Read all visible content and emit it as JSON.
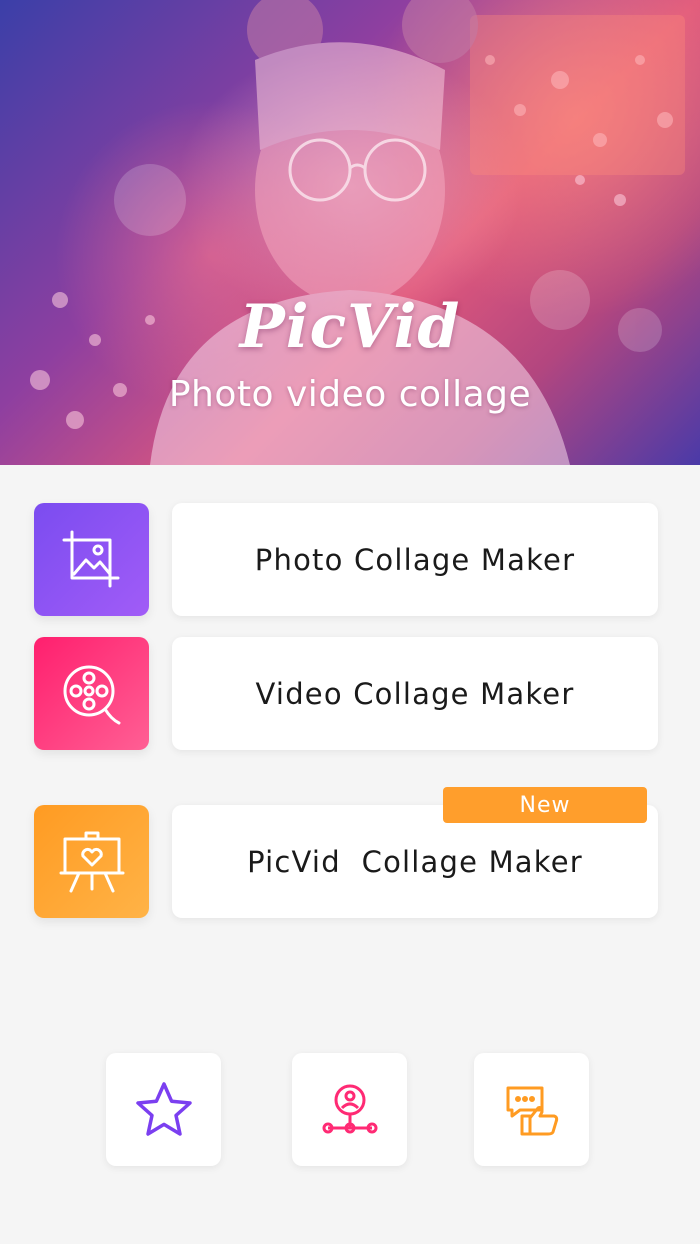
{
  "hero": {
    "title": "PicVid",
    "subtitle": "Photo video collage"
  },
  "menu": [
    {
      "label": "Photo Collage Maker",
      "icon": "crop-image-icon",
      "colors": [
        "#7b4cf0",
        "#a15cf7"
      ]
    },
    {
      "label": "Video Collage Maker",
      "icon": "film-reel-icon",
      "colors": [
        "#ff1f6e",
        "#ff5f94"
      ]
    },
    {
      "label": "PicVid  Collage Maker",
      "icon": "easel-heart-icon",
      "colors": [
        "#ff9b22",
        "#ffb347"
      ],
      "badge": "New"
    }
  ],
  "bottom": [
    {
      "icon": "star-icon",
      "color": "#7b3ff0"
    },
    {
      "icon": "profile-share-icon",
      "color": "#ff2a74"
    },
    {
      "icon": "feedback-like-icon",
      "color": "#ff9b22"
    }
  ]
}
